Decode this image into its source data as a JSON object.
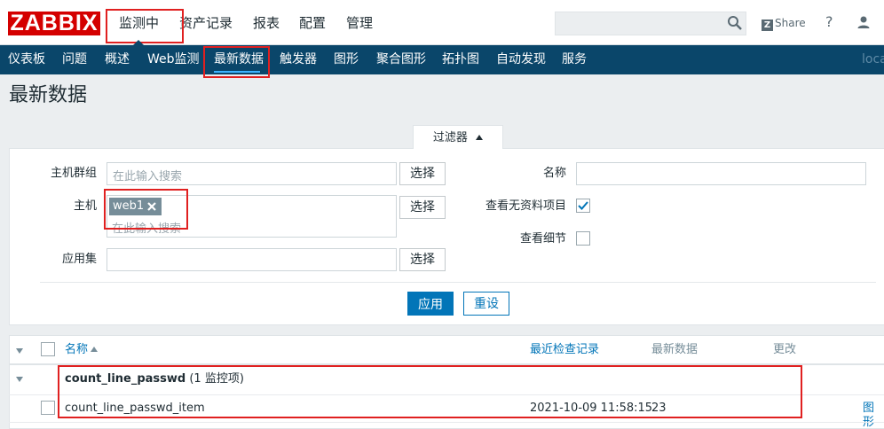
{
  "logo": "ZABBIX",
  "top_menu": {
    "monitoring": "监测中",
    "inventory": "资产记录",
    "reports": "报表",
    "configuration": "配置",
    "administration": "管理"
  },
  "top_right": {
    "share_z": "Z",
    "share_label": "Share",
    "help": "?"
  },
  "nav": {
    "dashboard": "仪表板",
    "problems": "问题",
    "overview": "概述",
    "web": "Web监测",
    "latest": "最新数据",
    "triggers": "触发器",
    "graphs": "图形",
    "screens": "聚合图形",
    "maps": "拓扑图",
    "discovery": "自动发现",
    "services": "服务",
    "local_cut": "loca"
  },
  "page_title": "最新数据",
  "filter": {
    "tab_label": "过滤器",
    "host_group_label": "主机群组",
    "host_group_placeholder": "在此输入搜索",
    "host_label": "主机",
    "host_tag": "web1",
    "host_placeholder": "在此输入搜索",
    "application_label": "应用集",
    "select_label": "选择",
    "name_label": "名称",
    "show_no_data_label": "查看无资料项目",
    "show_no_data_checked": true,
    "show_details_label": "查看细节",
    "show_details_checked": false,
    "apply": "应用",
    "reset": "重设"
  },
  "table": {
    "headers": {
      "name": "名称",
      "last_check": "最近检查记录",
      "last_value": "最新数据",
      "change": "更改"
    },
    "group": {
      "name": "count_line_passwd",
      "count": "(1 监控项)"
    },
    "rows": [
      {
        "name": "count_line_passwd_item",
        "last_check": "2021-10-09 11:58:15",
        "last_value": "23",
        "action": "图形"
      }
    ]
  }
}
